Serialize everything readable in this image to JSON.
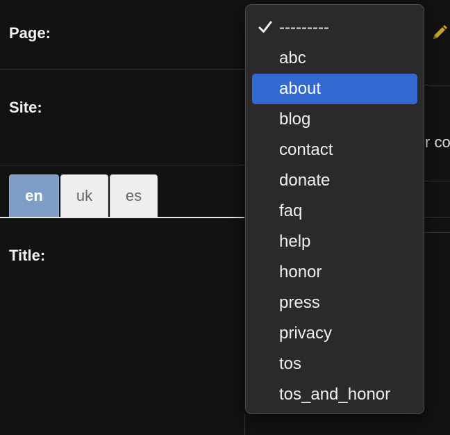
{
  "form": {
    "page_label": "Page:",
    "site_label": "Site:",
    "title_label": "Title:",
    "partial_text": "r co"
  },
  "tabs": [
    {
      "label": "en",
      "active": true
    },
    {
      "label": "uk",
      "active": false
    },
    {
      "label": "es",
      "active": false
    }
  ],
  "dropdown": {
    "selected": "---------",
    "highlighted": "about",
    "options": [
      "---------",
      "abc",
      "about",
      "blog",
      "contact",
      "donate",
      "faq",
      "help",
      "honor",
      "press",
      "privacy",
      "tos",
      "tos_and_honor"
    ]
  },
  "colors": {
    "highlight": "#3269d2",
    "active_tab": "#7f9ec7",
    "pencil": "#c9a227"
  },
  "icons": {
    "checkmark": "checkmark-icon",
    "edit": "pencil-icon"
  }
}
